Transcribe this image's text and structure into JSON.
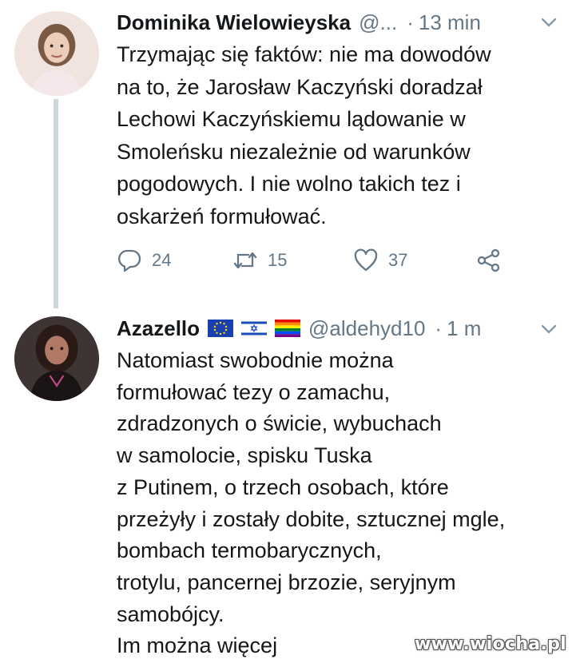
{
  "tweets": [
    {
      "author_name": "Dominika Wielowieyska",
      "handle": "@...",
      "separator": "·",
      "time": "13 min",
      "text_lines": [
        "Trzymając się faktów: nie ma dowodów",
        "na to, że Jarosław Kaczyński doradzał",
        "Lechowi Kaczyńskiemu lądowanie w",
        "Smoleńsku niezależnie od warunków",
        "pogodowych. I nie wolno takich tez i",
        "oskarżeń formułować."
      ],
      "actions": {
        "reply_count": "24",
        "retweet_count": "15",
        "like_count": "37"
      }
    },
    {
      "author_name": "Azazello",
      "flags": [
        "eu-flag-icon",
        "israel-flag-icon",
        "rainbow-flag-icon"
      ],
      "handle": "@aldehyd10",
      "separator": "·",
      "time": "1 m",
      "text_lines": [
        "Natomiast swobodnie można",
        "formułować tezy o zamachu,",
        "zdradzonych o świcie, wybuchach",
        "w samolocie, spisku Tuska",
        "z Putinem, o trzech osobach, które",
        "przeżyły i zostały dobite, sztucznej mgle,",
        "bombach termobarycznych,",
        "trotylu, pancernej brzozie, seryjnym",
        "samobójcy.",
        "Im można więcej"
      ]
    }
  ],
  "watermark": "www.wiocha.pl",
  "colors": {
    "text": "#14171a",
    "secondary": "#657786",
    "thread_line": "#ccd6dd"
  }
}
